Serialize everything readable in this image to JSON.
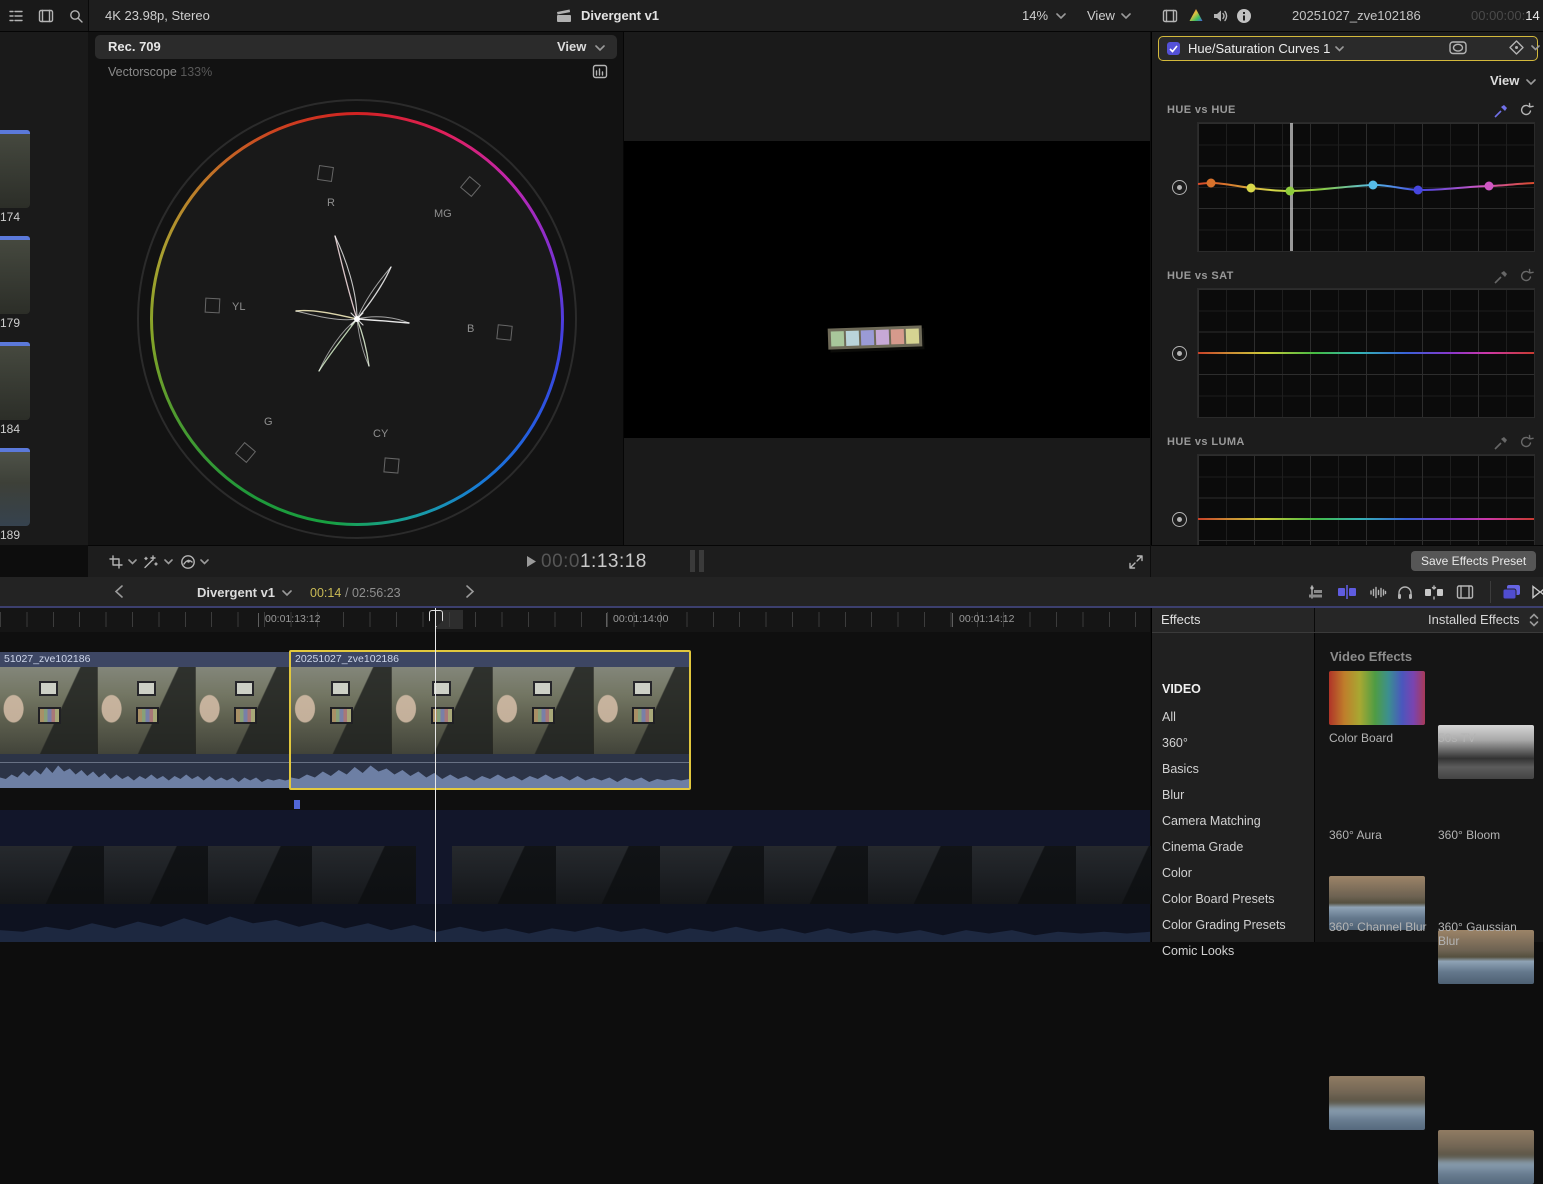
{
  "top_bar": {
    "format_info": "4K 23.98p, Stereo",
    "project_title": "Divergent v1",
    "zoom_level": "14%",
    "view_label": "View",
    "media_name": "20251027_zve102186",
    "timecode_dim": "00:00:00:",
    "timecode_value": "14"
  },
  "browser_strip": {
    "labels": [
      "174",
      "179",
      "184",
      "189"
    ]
  },
  "scope": {
    "header_title": "Rec. 709",
    "view_label": "View",
    "name": "Vectorscope",
    "zoom": "133%",
    "targets": {
      "r": "R",
      "mg": "MG",
      "yl": "YL",
      "b": "B",
      "g": "G",
      "cy": "CY"
    }
  },
  "viewer": {
    "timecode_dim": "00:0",
    "timecode_bright": "1:13:18"
  },
  "inspector": {
    "effect_name": "Hue/Saturation Curves 1",
    "view_label": "View",
    "save_preset_label": "Save Effects Preset",
    "sections": {
      "hue_hue": "HUE vs HUE",
      "hue_sat": "HUE vs SAT",
      "hue_luma": "HUE vs LUMA"
    },
    "hue_hue_points": [
      {
        "hue": "orange",
        "color": "#d8722c"
      },
      {
        "hue": "yellow",
        "color": "#d8d84a"
      },
      {
        "hue": "green",
        "color": "#8ecc3c"
      },
      {
        "hue": "cyan",
        "color": "#56bce8"
      },
      {
        "hue": "blue",
        "color": "#4646e0"
      },
      {
        "hue": "magenta",
        "color": "#cf57c4"
      }
    ]
  },
  "timeline": {
    "project_title": "Divergent v1",
    "position": "00:14",
    "duration": "/ 02:56:23",
    "ruler_marks": [
      "00:01:13:12",
      "00:01:14:00",
      "00:01:14:12"
    ],
    "clip_a_name": "51027_zve102186",
    "clip_b_name": "20251027_zve102186"
  },
  "effects": {
    "panel_title": "Effects",
    "filter_label": "Installed Effects",
    "categories": [
      "VIDEO",
      "All",
      "360°",
      "Basics",
      "Blur",
      "Camera Matching",
      "Cinema Grade",
      "Color",
      "Color Board Presets",
      "Color Grading Presets",
      "Comic Looks"
    ],
    "section_title": "Video Effects",
    "items": [
      "Color Board",
      "50s TV",
      "360° Aura",
      "360° Bloom",
      "360° Channel Blur",
      "360° Gaussian Blur"
    ]
  }
}
